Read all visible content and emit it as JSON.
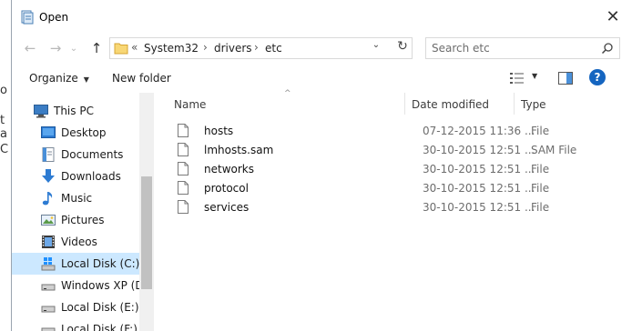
{
  "dialog": {
    "title": "Open",
    "close_glyph": "✕"
  },
  "navigation": {
    "back_glyph": "←",
    "forward_glyph": "→",
    "recent_glyph": "⌄",
    "up_glyph": "↑",
    "address": {
      "overflow": "«",
      "crumbs": [
        "System32",
        "drivers",
        "etc"
      ],
      "separator": "›"
    },
    "refresh_glyph": "↻",
    "dropdown_glyph": "⌄"
  },
  "search": {
    "placeholder": "Search etc"
  },
  "toolbar": {
    "organize": "Organize",
    "new_folder": "New folder",
    "caret": "▼",
    "help": "?"
  },
  "sidebar": {
    "items": [
      {
        "label": "This PC",
        "icon": "pc-icon"
      },
      {
        "label": "Desktop",
        "icon": "desktop-icon"
      },
      {
        "label": "Documents",
        "icon": "documents-icon"
      },
      {
        "label": "Downloads",
        "icon": "downloads-icon"
      },
      {
        "label": "Music",
        "icon": "music-icon"
      },
      {
        "label": "Pictures",
        "icon": "pictures-icon"
      },
      {
        "label": "Videos",
        "icon": "videos-icon"
      },
      {
        "label": "Local Disk (C:)",
        "icon": "windows-drive-icon",
        "selected": true
      },
      {
        "label": "Windows XP (D:)",
        "icon": "drive-icon"
      },
      {
        "label": "Local Disk (E:)",
        "icon": "drive-icon"
      },
      {
        "label": "Local Disk (F:)",
        "icon": "drive-icon"
      }
    ]
  },
  "file_list": {
    "columns": {
      "name": "Name",
      "date": "Date modified",
      "type": "Type",
      "sort_glyph": "^"
    },
    "rows": [
      {
        "name": "hosts",
        "date": "07-12-2015 11:36 ...",
        "type": "File"
      },
      {
        "name": "lmhosts.sam",
        "date": "30-10-2015 12:51 ...",
        "type": "SAM File"
      },
      {
        "name": "networks",
        "date": "30-10-2015 12:51 ...",
        "type": "File"
      },
      {
        "name": "protocol",
        "date": "30-10-2015 12:51 ...",
        "type": "File"
      },
      {
        "name": "services",
        "date": "30-10-2015 12:51 ...",
        "type": "File"
      }
    ]
  },
  "background_window": {
    "glyphs": [
      "o",
      "t",
      "a",
      "C"
    ]
  },
  "colors": {
    "selection": "#cce8ff",
    "help": "#1565c0",
    "folder": "#f8d775"
  }
}
